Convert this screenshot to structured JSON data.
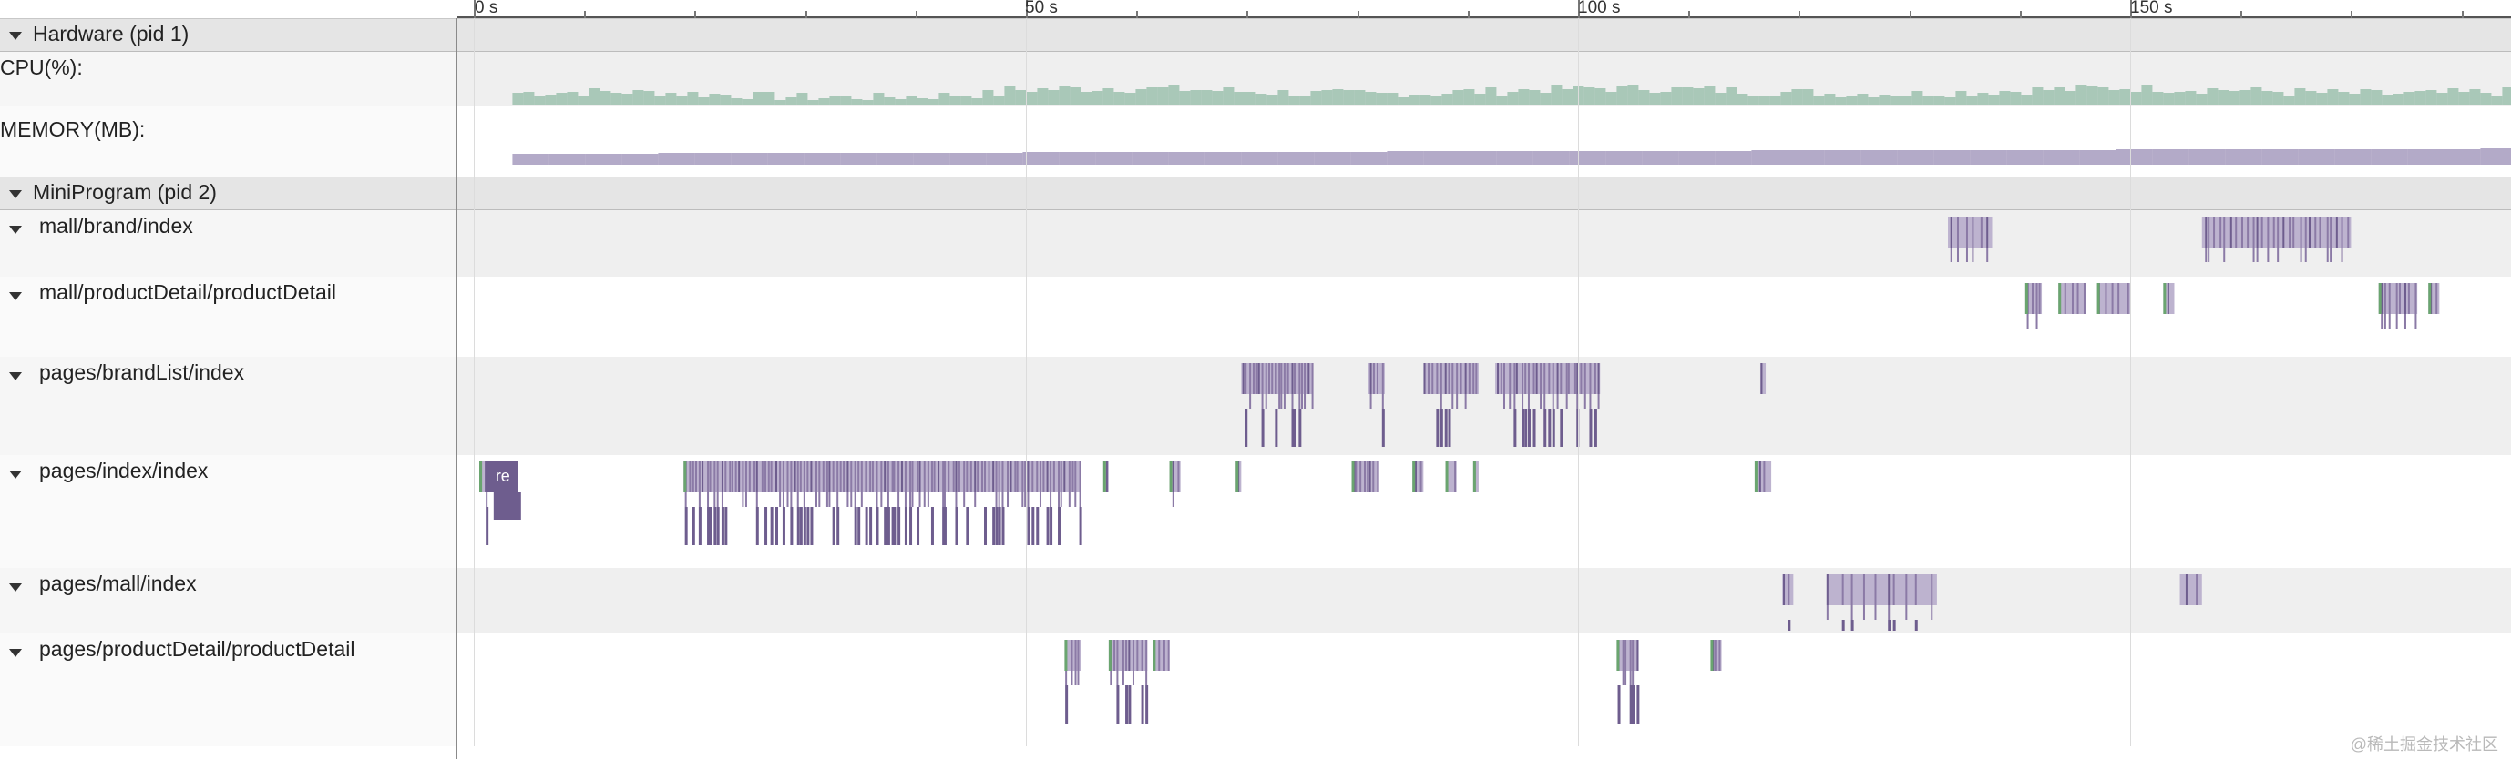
{
  "ruler": {
    "ticks": [
      "0 s",
      "50 s",
      "100 s",
      "150 s"
    ]
  },
  "groups": {
    "hardware": {
      "label": "Hardware (pid 1)"
    },
    "miniprogram": {
      "label": "MiniProgram (pid 2)"
    }
  },
  "counters": {
    "cpu": {
      "label": "CPU(%):",
      "color": "#a9c8b8"
    },
    "memory": {
      "label": "MEMORY(MB):",
      "color": "#b3aac8"
    }
  },
  "threads": [
    {
      "label": "mall/brand/index"
    },
    {
      "label": "mall/productDetail/productDetail"
    },
    {
      "label": "pages/brandList/index"
    },
    {
      "label": "pages/index/index"
    },
    {
      "label": "pages/mall/index"
    },
    {
      "label": "pages/productDetail/productDetail"
    }
  ],
  "slice_label": "re",
  "colors": {
    "slice_purple": "#8b7aa6",
    "slice_dark": "#6e5d8e",
    "slice_green": "#6aa56f",
    "slice_light": "#bdb3cf"
  },
  "watermark": "@稀土掘金技术社区"
}
